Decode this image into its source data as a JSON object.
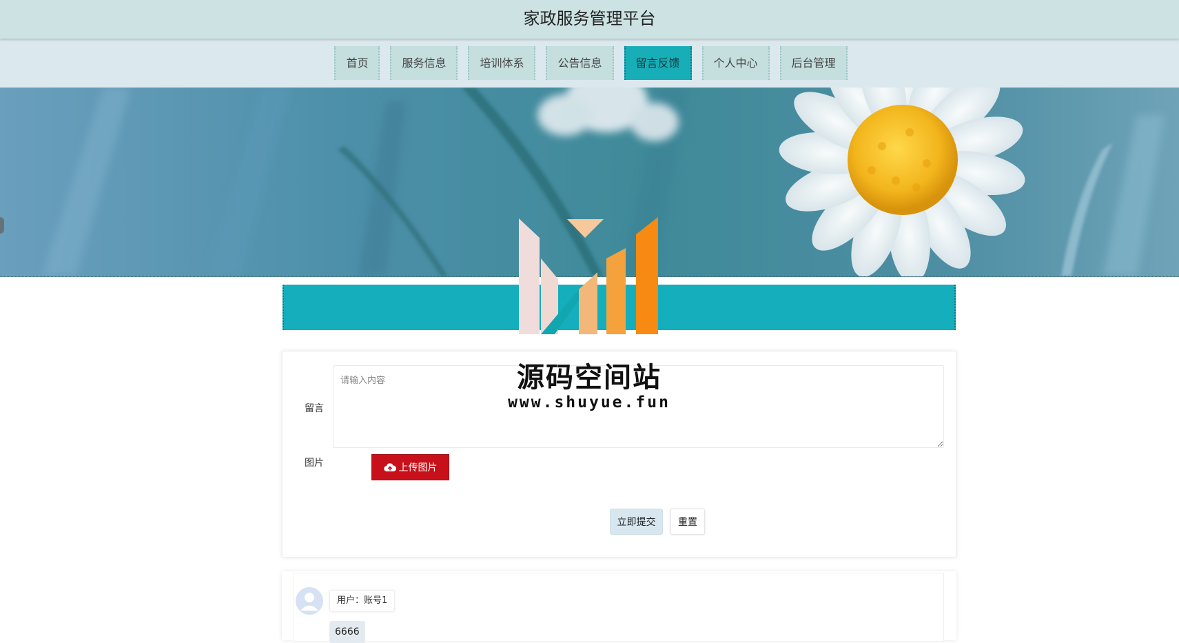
{
  "header": {
    "title": "家政服务管理平台"
  },
  "nav": {
    "items": [
      {
        "label": "首页"
      },
      {
        "label": "服务信息"
      },
      {
        "label": "培训体系"
      },
      {
        "label": "公告信息"
      },
      {
        "label": "留言反馈"
      },
      {
        "label": "个人中心"
      },
      {
        "label": "后台管理"
      }
    ],
    "active": "留言反馈"
  },
  "form": {
    "message_label": "留言",
    "message_placeholder": "请输入内容",
    "image_label": "图片",
    "upload_label": "上传图片",
    "submit_label": "立即提交",
    "reset_label": "重置"
  },
  "comments": [
    {
      "user": "用户：账号1",
      "content": "6666"
    }
  ],
  "watermark": {
    "name": "源码空间站",
    "url": "www.shuyue.fun"
  },
  "colors": {
    "header_bg": "#cde3e3",
    "nav_bg": "#dbe8ee",
    "nav_item_bg": "#c5dede",
    "accent_teal": "#14aebc",
    "upload_red": "#c8101a",
    "submit_bg": "#d8e7ef"
  },
  "icons": [
    "cloud-upload-icon",
    "avatar-icon"
  ]
}
